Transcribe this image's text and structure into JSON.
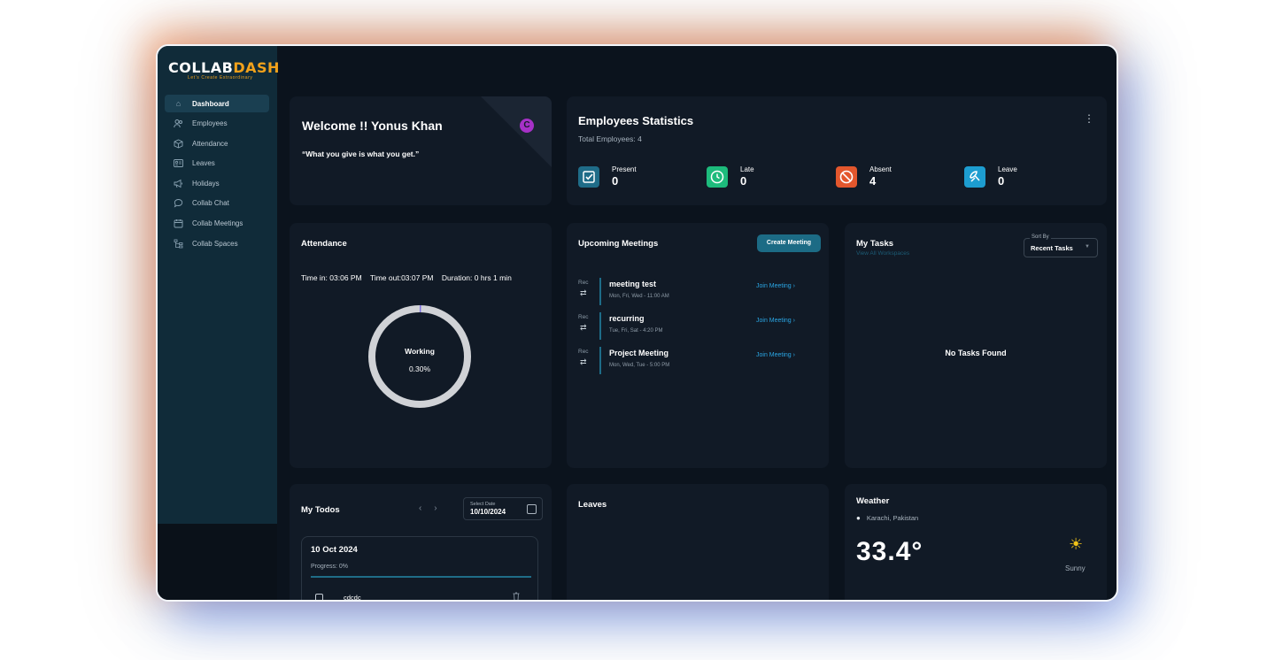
{
  "app": {
    "logo": {
      "part1": "COLLAB",
      "part2": "DASH",
      "tagline": "Let's Create Extraordinary"
    }
  },
  "sidebar": {
    "items": [
      {
        "label": "Dashboard",
        "icon": "home-icon",
        "active": true
      },
      {
        "label": "Employees",
        "icon": "users-icon"
      },
      {
        "label": "Attendance",
        "icon": "cube-icon"
      },
      {
        "label": "Leaves",
        "icon": "id-card-icon"
      },
      {
        "label": "Holidays",
        "icon": "megaphone-icon"
      },
      {
        "label": "Collab Chat",
        "icon": "chat-icon"
      },
      {
        "label": "Collab Meetings",
        "icon": "calendar-icon"
      },
      {
        "label": "Collab Spaces",
        "icon": "hierarchy-icon"
      }
    ]
  },
  "welcome": {
    "title": "Welcome !! Yonus Khan",
    "quote": "“What you give is what you get.”",
    "badge": "C"
  },
  "stats": {
    "title": "Employees Statistics",
    "subtitle": "Total Employees: 4",
    "items": [
      {
        "label": "Present",
        "value": "0",
        "icon": "check-square-icon",
        "color": "#1f6c88"
      },
      {
        "label": "Late",
        "value": "0",
        "icon": "clock-icon",
        "color": "#1dbb7c"
      },
      {
        "label": "Absent",
        "value": "4",
        "icon": "ban-icon",
        "color": "#e3572d"
      },
      {
        "label": "Leave",
        "value": "0",
        "icon": "beach-umbrella-icon",
        "color": "#1d9dd0"
      }
    ]
  },
  "attendance": {
    "title": "Attendance",
    "time_in": "Time in: 03:06 PM",
    "time_out": "Time out:03:07 PM",
    "duration": "Duration: 0 hrs 1 min",
    "status": "Working",
    "percent_label": "0.30%",
    "percent": 0.3
  },
  "meetings": {
    "title": "Upcoming Meetings",
    "create_label": "Create Meeting",
    "items": [
      {
        "rec": "Rec",
        "name": "meeting test",
        "schedule": "Mon, Fri, Wed - 11:00 AM",
        "join": "Join Meeting  ›"
      },
      {
        "rec": "Rec",
        "name": "recurring",
        "schedule": "Tue, Fri, Sat - 4:20 PM",
        "join": "Join Meeting  ›"
      },
      {
        "rec": "Rec",
        "name": "Project Meeting",
        "schedule": "Mon, Wed, Tue - 5:00 PM",
        "join": "Join Meeting  ›"
      }
    ]
  },
  "tasks": {
    "title": "My Tasks",
    "view_all": "View All Workspaces",
    "sort_label": "Sort By",
    "sort_value": "Recent Tasks",
    "empty": "No Tasks Found"
  },
  "todos": {
    "title": "My Todos",
    "date_label": "Select Date",
    "date_value": "10/10/2024",
    "group_date": "10 Oct 2024",
    "progress_label": "Progress: 0%",
    "progress": 0,
    "items": [
      {
        "text": "cdcdc"
      }
    ]
  },
  "leaves": {
    "title": "Leaves"
  },
  "weather": {
    "title": "Weather",
    "location": "Karachi, Pakistan",
    "temperature": "33.4°",
    "condition": "Sunny",
    "sun_color": "#f2c418"
  }
}
